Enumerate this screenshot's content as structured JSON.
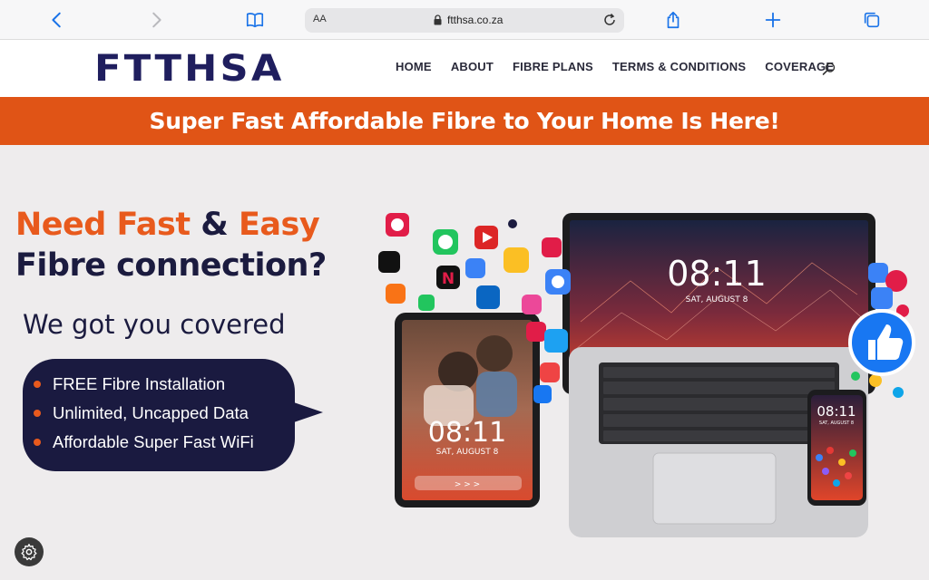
{
  "browser": {
    "text_size_label": "AA",
    "url": "ftthsa.co.za"
  },
  "site": {
    "logo": "FTTHSA",
    "nav": [
      "HOME",
      "ABOUT",
      "FIBRE PLANS",
      "TERMS & CONDITIONS",
      "COVERAGE"
    ]
  },
  "banner": {
    "text": "Super Fast Affordable Fibre to Your Home Is Here!"
  },
  "hero": {
    "headline_need_fast": "Need Fast",
    "headline_amp": "&",
    "headline_easy": "Easy",
    "headline_line2": "Fibre connection?",
    "subheadline": "We got you covered",
    "features": [
      "FREE Fibre Installation",
      "Unlimited, Uncapped Data",
      "Affordable Super Fast WiFi"
    ]
  },
  "devices": {
    "laptop_time": "08:11",
    "laptop_date": "SAT, AUGUST 8",
    "tablet_time": "08:11",
    "tablet_date": "SAT, AUGUST 8",
    "tablet_unlock": "> > >",
    "phone_time": "08:11",
    "phone_date": "SAT, AUGUST 8"
  },
  "colors": {
    "brand_navy": "#1b1b3f",
    "brand_orange": "#e05416",
    "link_blue": "#1a73e8"
  }
}
